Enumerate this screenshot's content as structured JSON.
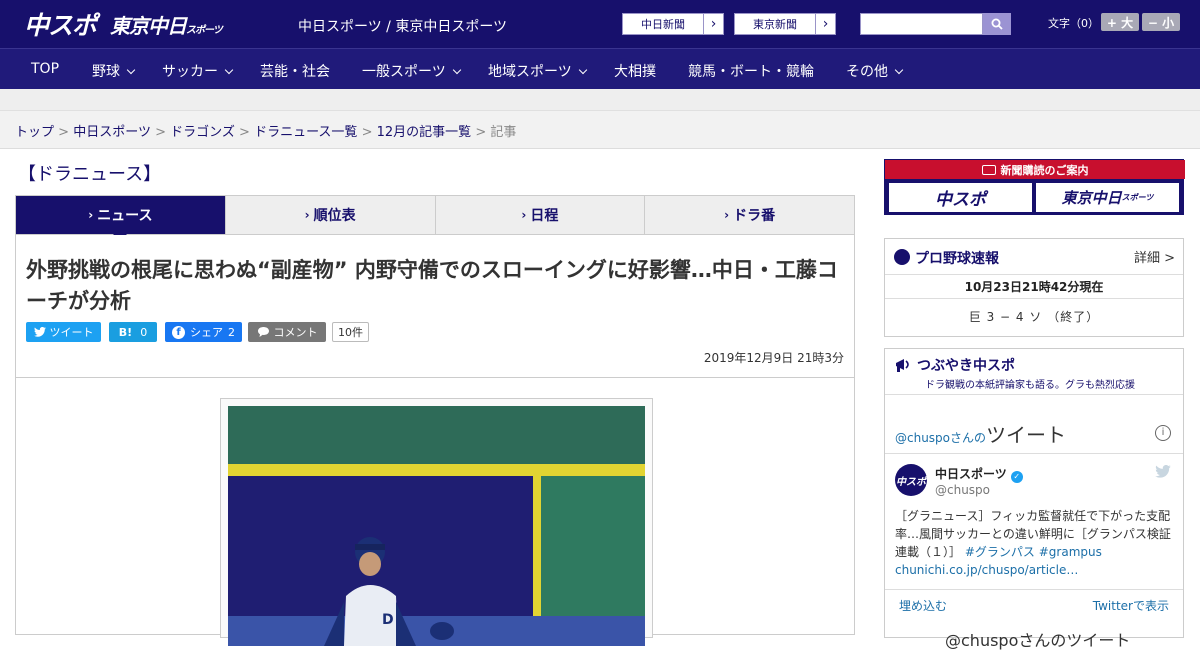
{
  "header": {
    "logo_main": "中スポ",
    "logo_tokyo": "東京中日",
    "logo_tokyo_small": "スポーツ",
    "site_name": "中日スポーツ / 東京中日スポーツ",
    "ext_links": [
      {
        "label": "中日新聞"
      },
      {
        "label": "東京新聞"
      }
    ],
    "search_placeholder": "",
    "font_size_label": "文字（0）",
    "font_bigger": "+ 大",
    "font_smaller": "− 小"
  },
  "nav": {
    "items": [
      {
        "label": "TOP"
      },
      {
        "label": "野球"
      },
      {
        "label": "サッカー"
      },
      {
        "label": "芸能・社会"
      },
      {
        "label": "一般スポーツ"
      },
      {
        "label": "地域スポーツ"
      },
      {
        "label": "大相撲"
      },
      {
        "label": "競馬・ボート・競輪"
      },
      {
        "label": "その他"
      }
    ]
  },
  "breadcrumb": {
    "items": [
      "トップ",
      "中日スポーツ",
      "ドラゴンズ",
      "ドラニュース一覧",
      "12月の記事一覧"
    ],
    "current": "記事",
    "separator": ">"
  },
  "page_title": "【ドラニュース】",
  "tabs": [
    {
      "label": "ニュース"
    },
    {
      "label": "順位表"
    },
    {
      "label": "日程"
    },
    {
      "label": "ドラ番"
    }
  ],
  "article": {
    "headline": "外野挑戦の根尾に思わぬ“副産物” 内野守備でのスローイングに好影響…中日・工藤コーチが分析",
    "share": {
      "tweet_label": "ツイート",
      "hatena_label": "B!",
      "hatena_count": "0",
      "facebook_label": "シェア",
      "facebook_count": "2",
      "comment_label": "コメント",
      "comment_count": "10件"
    },
    "date": "2019年12月9日 21時3分"
  },
  "sidebar": {
    "subscription": {
      "title": "新聞購読のご案内",
      "btn1": "中スポ",
      "btn2": "東京中日",
      "btn2_small": "スポーツ"
    },
    "baseball": {
      "title": "プロ野球速報",
      "detail": "詳細 >",
      "time": "10月23日21時42分現在",
      "score": "巨 3 − 4 ソ （終了）"
    },
    "twitter": {
      "title": "つぶやき中スポ",
      "subtitle": "ドラ観戦の本紙評論家も語る。グラも熱烈応援",
      "owner_prefix": "@chuspoさんの",
      "owner_suffix": "ツイート",
      "account_name": "中日スポーツ",
      "handle": "@chuspo",
      "tweet_text": "［グラニュース］フィッカ監督就任で下がった支配率…風間サッカーとの違い鮮明に［グランパス検証連載（１）］",
      "hashtag1": "#グランパス",
      "hashtag2": "#grampus",
      "link": "chunichi.co.jp/chuspo/article…",
      "embed_label": "埋め込む",
      "view_label": "Twitterで表示",
      "bottom_text": "@chuspoさんのツイート"
    }
  },
  "colors": {
    "brand_navy": "#17106c",
    "nav_bg": "#201a7a",
    "subscribe_red": "#c80f2e",
    "twitter_blue": "#1da1f2",
    "hatena_blue": "#1a9ee0",
    "facebook_blue": "#1877f2",
    "comment_gray": "#777777"
  }
}
